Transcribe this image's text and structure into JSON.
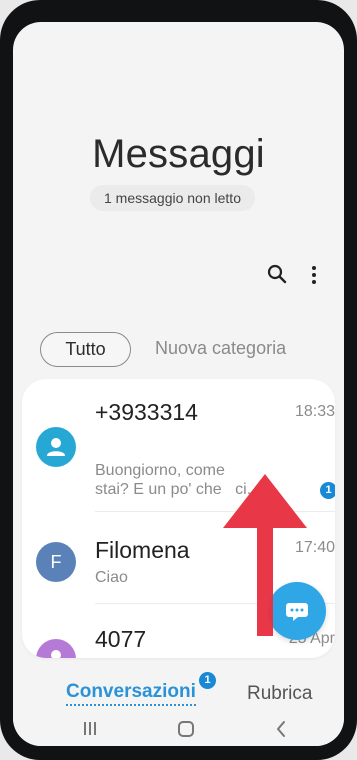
{
  "header": {
    "title": "Messaggi",
    "unread_summary": "1 messaggio non letto"
  },
  "toolbar": {
    "search_icon": "search-icon",
    "menu_icon": "more-vert-icon"
  },
  "filters": {
    "active": "Tutto",
    "inactive": "Nuova categoria"
  },
  "conversations": [
    {
      "name": "+3933314",
      "time": "18:33",
      "preview_line1": "Buongiorno, come",
      "preview_line2": "stai? E un po' che",
      "preview_trailing": "ci...",
      "unread_count": "1",
      "avatar_icon": "person-icon",
      "avatar_color": "#27a8d4"
    },
    {
      "name": "Filomena",
      "time": "17:40",
      "preview": "Ciao",
      "avatar_letter": "F",
      "avatar_color": "#5a81b8"
    },
    {
      "name": "4077",
      "time": "25 Apr",
      "avatar_icon": "person-icon",
      "avatar_color": "#b57ad6"
    }
  ],
  "fab": {
    "icon": "new-message-icon",
    "color": "#2fa7e6"
  },
  "overlay": {
    "arrow_color": "#e7303f"
  },
  "bottom_tabs": {
    "conversations": "Conversazioni",
    "conversations_badge": "1",
    "contacts": "Rubrica"
  },
  "colors": {
    "accent": "#2a93d5",
    "badge": "#1989d6"
  }
}
